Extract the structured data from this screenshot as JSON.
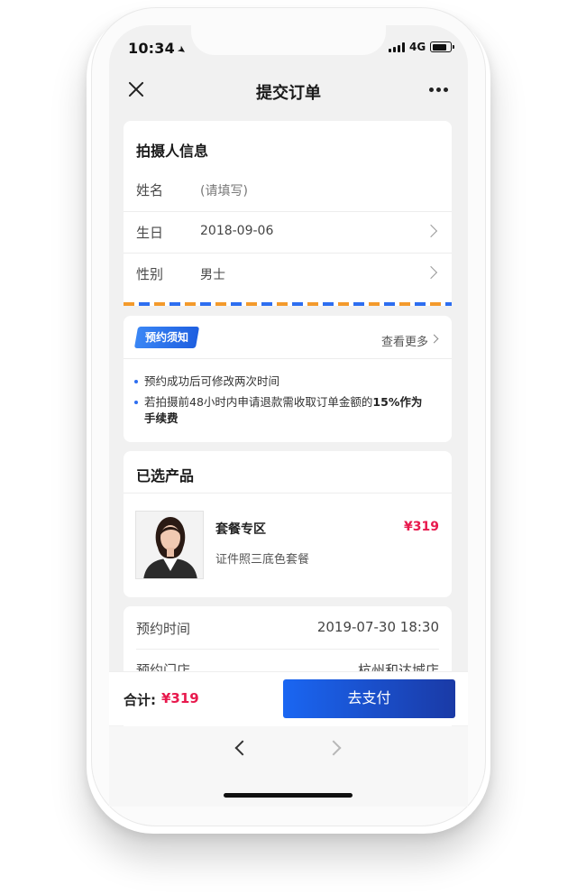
{
  "status_bar": {
    "time": "10:34",
    "location_icon": "location-arrow-icon",
    "network": "4G"
  },
  "nav": {
    "title": "提交订单",
    "close_icon": "close-icon",
    "more_icon": "more-dots-icon"
  },
  "photographer_info": {
    "title": "拍摄人信息",
    "name_label": "姓名",
    "name_value": "(请填写)",
    "birthday_label": "生日",
    "birthday_value": "2018-09-06",
    "gender_label": "性别",
    "gender_value": "男士"
  },
  "notice": {
    "badge": "预约须知",
    "view_more": "查看更多",
    "item1": "预约成功后可修改两次时间",
    "item2_prefix": "若拍摄前48小时内申请退款需收取订单金额的",
    "item2_bold": "15%作为",
    "item2_suffix": "手续费"
  },
  "product": {
    "section_title": "已选产品",
    "name": "套餐专区",
    "price": "¥319",
    "description": "证件照三底色套餐"
  },
  "booking": {
    "time_label": "预约时间",
    "time_value": "2019-07-30 18:30",
    "store_label": "预约门店",
    "store_value": "杭州和达城店"
  },
  "pay_bar": {
    "total_label": "合计:",
    "total_value": "¥319",
    "pay_button": "去支付"
  },
  "colors": {
    "accent_blue": "#1a66f2",
    "price_red": "#e8194d",
    "airmail_orange": "#f39a2c"
  }
}
